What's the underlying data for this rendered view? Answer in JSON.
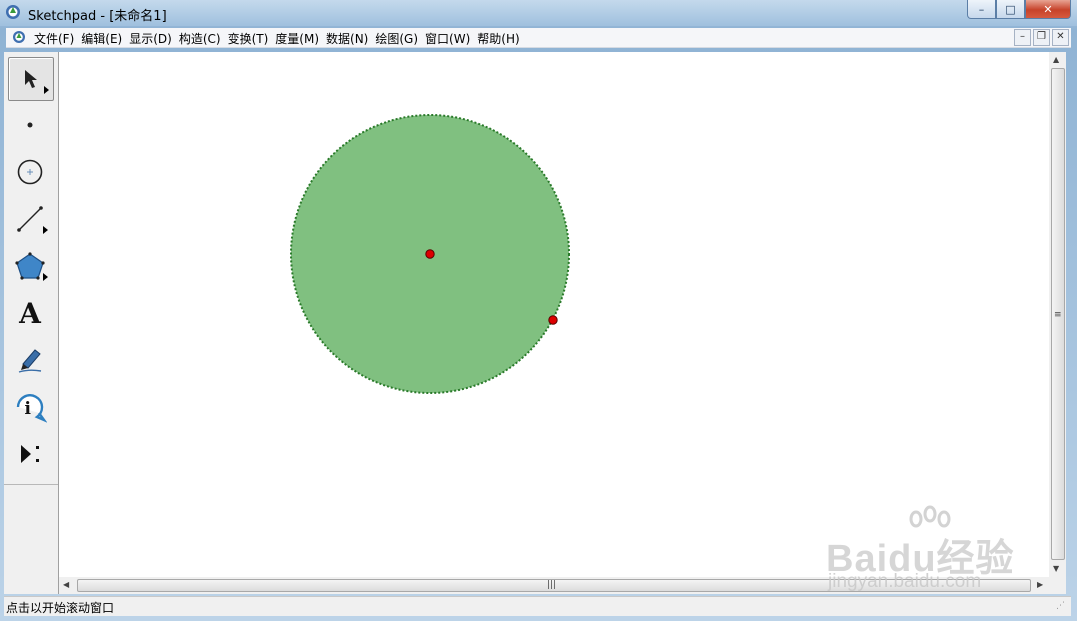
{
  "window": {
    "title": "Sketchpad  - [未命名1]",
    "controls": {
      "minimize": "–",
      "maximize": "□",
      "close": "✕"
    }
  },
  "menubar": {
    "items": [
      "文件(F)",
      "编辑(E)",
      "显示(D)",
      "构造(C)",
      "变换(T)",
      "度量(M)",
      "数据(N)",
      "绘图(G)",
      "窗口(W)",
      "帮助(H)"
    ],
    "doc_controls": {
      "minimize": "–",
      "restore": "❐",
      "close": "✕"
    }
  },
  "toolbox": {
    "tools": [
      {
        "name": "arrow-tool-icon",
        "active": true,
        "has_submenu": true
      },
      {
        "name": "point-tool-icon",
        "active": false,
        "has_submenu": false
      },
      {
        "name": "compass-tool-icon",
        "active": false,
        "has_submenu": false
      },
      {
        "name": "straightedge-tool-icon",
        "active": false,
        "has_submenu": true
      },
      {
        "name": "polygon-tool-icon",
        "active": false,
        "has_submenu": true
      },
      {
        "name": "text-tool-icon",
        "active": false,
        "has_submenu": false,
        "glyph": "A"
      },
      {
        "name": "marker-tool-icon",
        "active": false,
        "has_submenu": false
      },
      {
        "name": "information-tool-icon",
        "active": false,
        "has_submenu": false
      },
      {
        "name": "custom-tool-icon",
        "active": false,
        "has_submenu": false
      }
    ]
  },
  "canvas": {
    "circle": {
      "fill": "#80c080",
      "stroke": "#2a7a2a"
    },
    "points": [
      {
        "role": "center",
        "color": "#dd0000"
      },
      {
        "role": "radius-point",
        "color": "#dd0000"
      }
    ]
  },
  "statusbar": {
    "text": "点击以开始滚动窗口"
  },
  "watermark": {
    "brand": "Baidu经验",
    "url": "jingyan.baidu.com"
  }
}
